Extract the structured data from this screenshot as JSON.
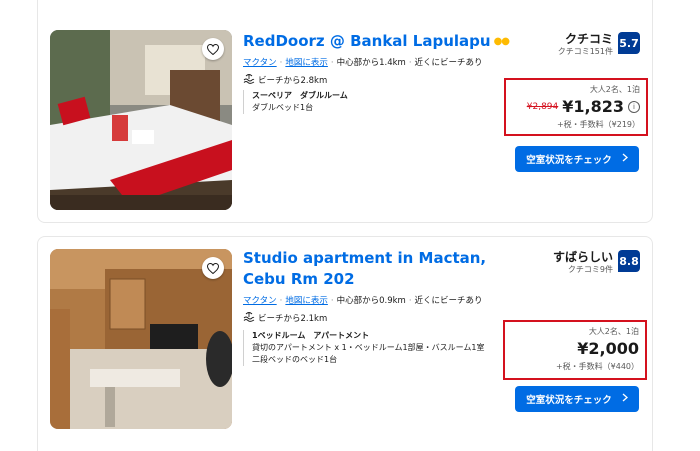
{
  "listings": [
    {
      "title": "RedDoorz @ Bankal Lapulapu",
      "area_link": "マクタン",
      "map_link": "地図に表示",
      "distance_center": "中心部から1.4km",
      "beach_note": "近くにビーチあり",
      "beach_distance": "ビーチから2.8km",
      "room_type": "スーペリア　ダブルルーム",
      "room_details": [
        "ダブルベッド1台"
      ],
      "review_label": "クチコミ",
      "review_count": "クチコミ151件",
      "score": "5.7",
      "stay_info": "大人2名、1泊",
      "old_price": "¥2,894",
      "price": "¥1,823",
      "tax_info": "+税・手数料（¥219）",
      "cta": "空室状況をチェック"
    },
    {
      "title": "Studio apartment in Mactan, Cebu Rm 202",
      "area_link": "マクタン",
      "map_link": "地図に表示",
      "distance_center": "中心部から0.9km",
      "beach_note": "近くにビーチあり",
      "beach_distance": "ビーチから2.1km",
      "room_type": "1ベッドルーム　アパートメント",
      "room_details": [
        "貸切のアパートメント x 1・ベッドルーム1部屋・バスルーム1室",
        "二段ベッドのベッド1台"
      ],
      "review_label": "すばらしい",
      "review_count": "クチコミ9件",
      "score": "8.8",
      "stay_info": "大人2名、1泊",
      "price": "¥2,000",
      "tax_info": "+税・手数料（¥440）",
      "cta": "空室状況をチェック"
    }
  ]
}
